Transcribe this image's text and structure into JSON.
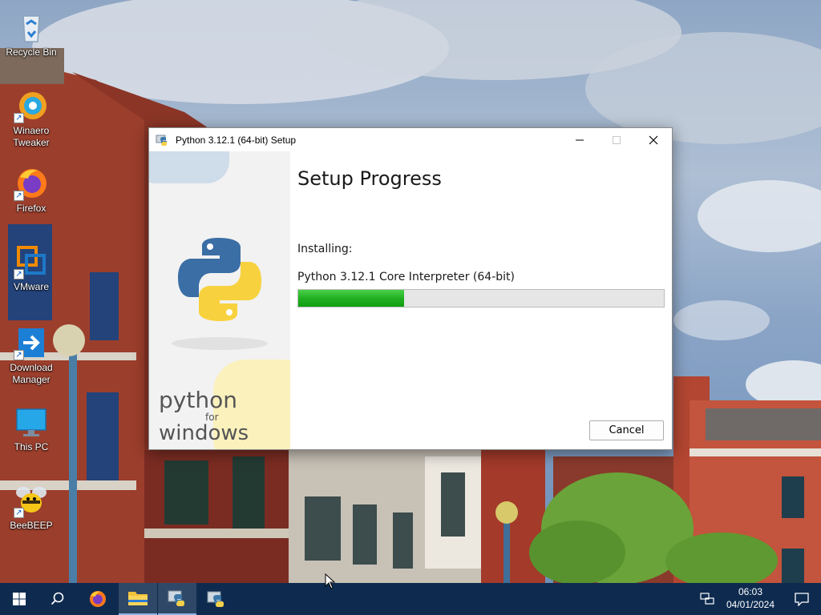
{
  "desktop": {
    "icons": [
      {
        "label": "Recycle Bin",
        "icon": "recycle-bin-icon"
      },
      {
        "label": "Winaero Tweaker",
        "icon": "winaero-tweaker-icon"
      },
      {
        "label": "Firefox",
        "icon": "firefox-icon"
      },
      {
        "label": "VMware",
        "icon": "vmware-icon"
      },
      {
        "label": "Download Manager",
        "icon": "download-manager-icon"
      },
      {
        "label": "This PC",
        "icon": "this-pc-icon"
      },
      {
        "label": "BeeBEEP",
        "icon": "beebeep-icon"
      }
    ]
  },
  "window": {
    "title": "Python 3.12.1 (64-bit) Setup",
    "minimize": "—",
    "maximize": "☐",
    "close": "✕",
    "sidebar_brand_line1": "python",
    "sidebar_brand_line2": "for",
    "sidebar_brand_line3": "windows",
    "heading": "Setup Progress",
    "status_label": "Installing:",
    "component": "Python 3.12.1 Core Interpreter (64-bit)",
    "progress_fraction": 0.29,
    "cancel_label": "Cancel"
  },
  "taskbar": {
    "items": [
      "start-icon",
      "search-icon",
      "firefox-icon",
      "file-explorer-icon",
      "python-setup-icon",
      "python-setup-icon"
    ],
    "time": "06:03",
    "date": "04/01/2024"
  },
  "colors": {
    "taskbar": "#0e2b4f",
    "progress_fill": "#22b022",
    "progress_track": "#e6e6e6"
  }
}
